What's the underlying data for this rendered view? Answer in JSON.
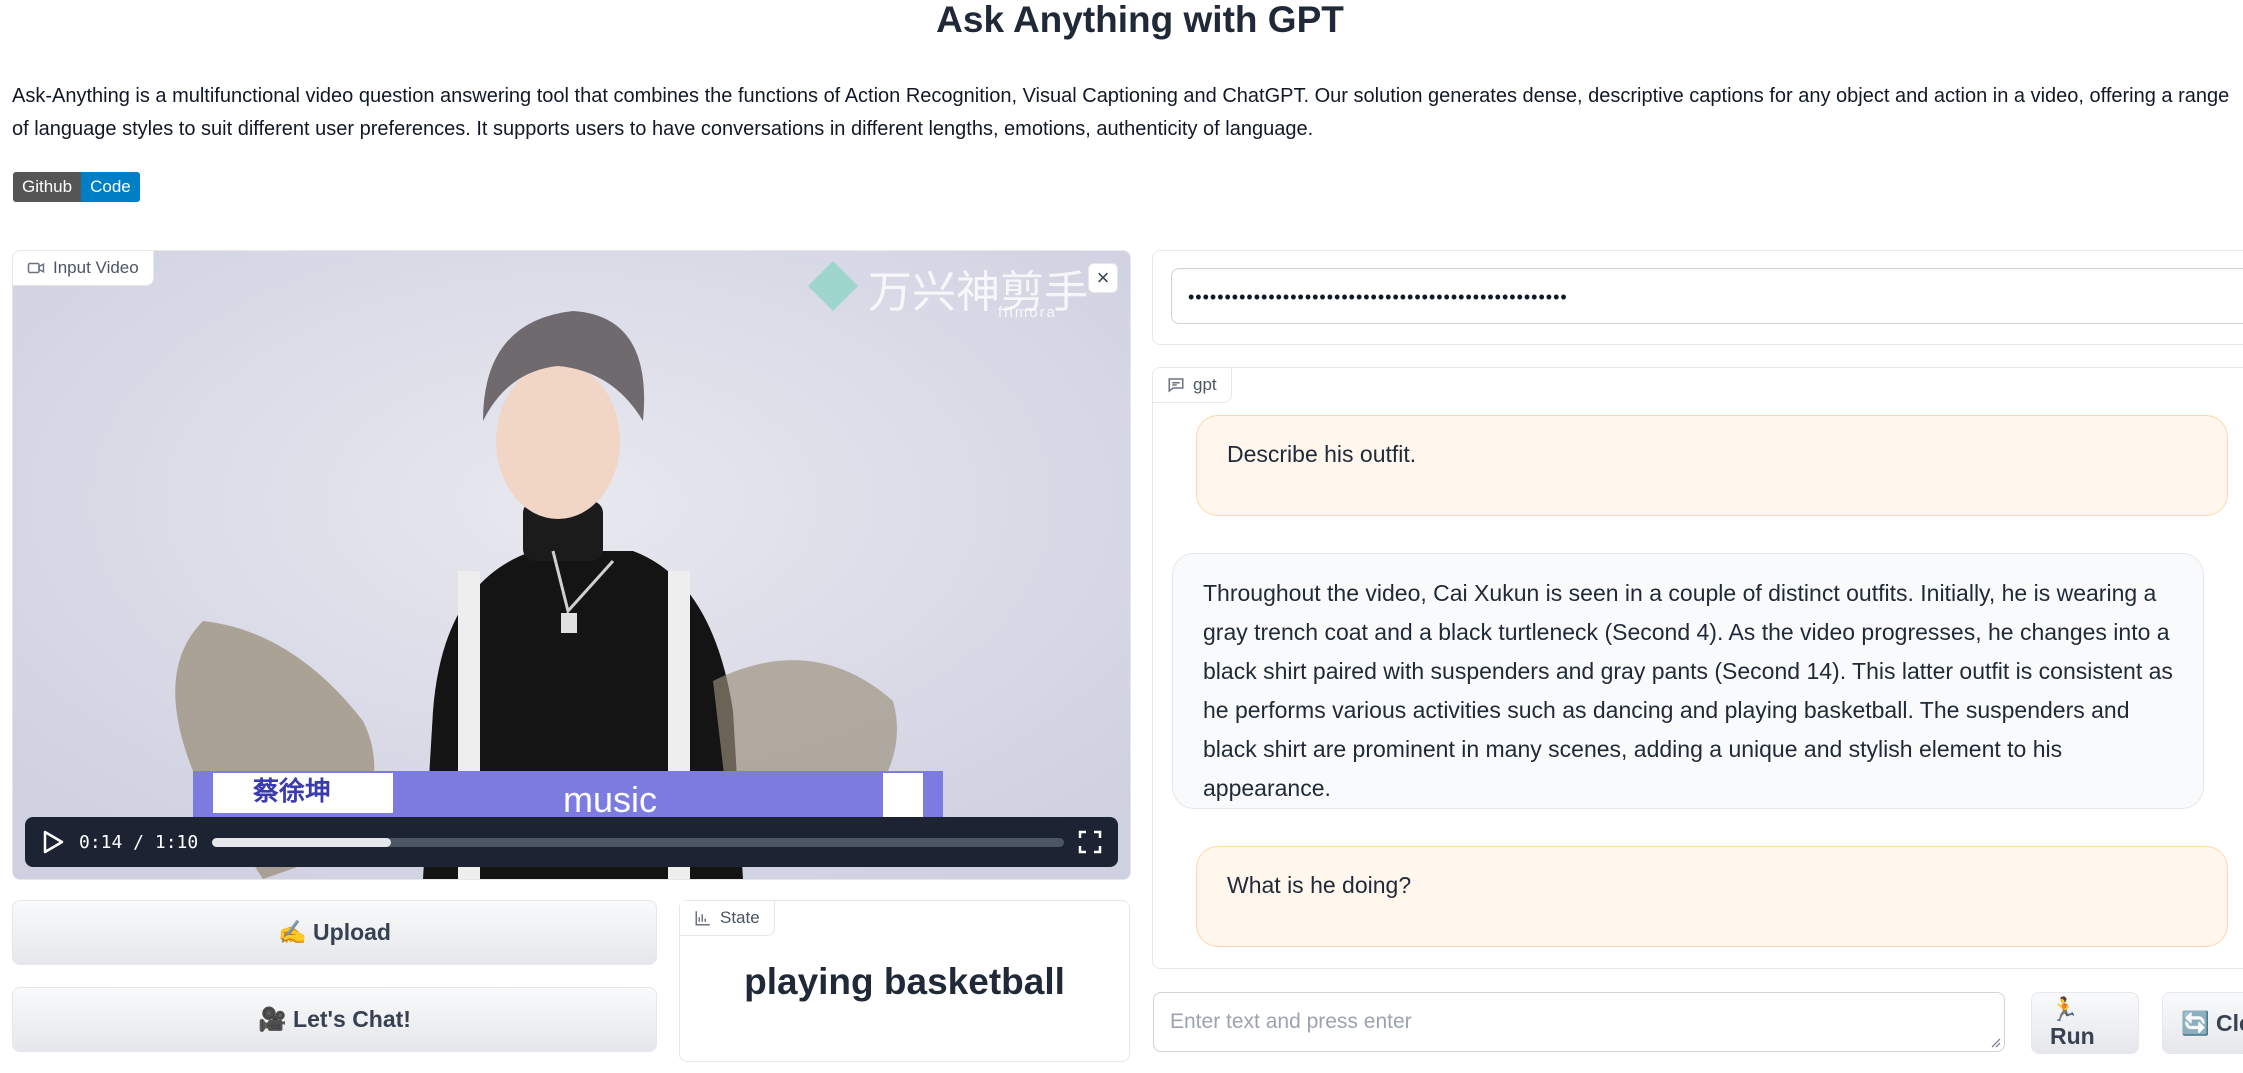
{
  "page": {
    "title": "Ask Anything with GPT",
    "description": "Ask-Anything is a multifunctional video question answering tool that combines the functions of Action Recognition, Visual Captioning and ChatGPT. Our solution generates dense, descriptive captions for any object and action in a video, offering a range of language styles to suit different user preferences. It supports users to have conversations in different lengths, emotions, authenticity of language.",
    "badge": {
      "left": "Github",
      "right": "Code"
    }
  },
  "video": {
    "label": "Input Video",
    "close": "×",
    "time": "0:14 / 1:10",
    "progress_fraction": 0.21,
    "overlay_name": "蔡徐坤",
    "overlay_text": "music",
    "watermark": "万兴神剪手",
    "watermark_sub": "filmora"
  },
  "buttons": {
    "upload": "✍️ Upload",
    "chat": "🎥 Let's Chat!"
  },
  "state": {
    "label": "State",
    "value": "playing basketball"
  },
  "api_key": {
    "value": "••••••••••••••••••••••••••••••••••••••••••••••••••••"
  },
  "chat": {
    "label": "gpt",
    "messages": [
      {
        "role": "user",
        "text": "Describe his outfit."
      },
      {
        "role": "bot",
        "text": "Throughout the video, Cai Xukun is seen in a couple of distinct outfits. Initially, he is wearing a gray trench coat and a black turtleneck (Second 4). As the video progresses, he changes into a black shirt paired with suspenders and gray pants (Second 14). This latter outfit is consistent as he performs various activities such as dancing and playing basketball. The suspenders and black shirt are prominent in many scenes, adding a unique and stylish element to his appearance."
      },
      {
        "role": "user",
        "text": "What is he doing?"
      }
    ]
  },
  "input": {
    "placeholder": "Enter text and press enter",
    "run": "🏃 Run",
    "clear": "🔄 Clea"
  }
}
